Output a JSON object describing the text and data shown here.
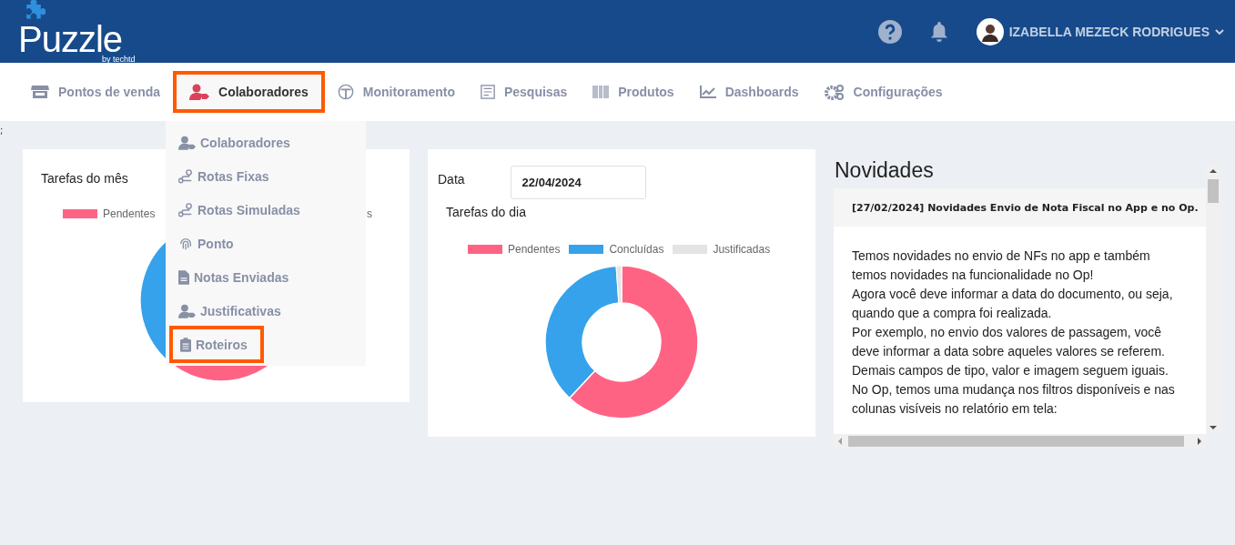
{
  "header": {
    "logo": {
      "name": "Puzzle",
      "tagline": "by techtd"
    },
    "user": {
      "name": "IZABELLA MEZECK RODRIGUES"
    }
  },
  "nav": [
    {
      "label": "Pontos de venda",
      "selected": false
    },
    {
      "label": "Colaboradores",
      "selected": true
    },
    {
      "label": "Monitoramento",
      "selected": false
    },
    {
      "label": "Pesquisas",
      "selected": false
    },
    {
      "label": "Produtos",
      "selected": false
    },
    {
      "label": "Dashboards",
      "selected": false
    },
    {
      "label": "Configurações",
      "selected": false
    }
  ],
  "dropdown": [
    {
      "label": "Colaboradores",
      "selected": false
    },
    {
      "label": "Rotas Fixas",
      "selected": false
    },
    {
      "label": "Rotas Simuladas",
      "selected": false
    },
    {
      "label": "Ponto",
      "selected": false
    },
    {
      "label": "Notas Enviadas",
      "selected": false
    },
    {
      "label": "Justificativas",
      "selected": false
    },
    {
      "label": "Roteiros",
      "selected": true
    }
  ],
  "stray_mark": ";",
  "month_card": {
    "title": "Tarefas do mês",
    "legend": [
      {
        "label": "Pendentes",
        "color": "#ff6384"
      }
    ],
    "legend_fragment": "s"
  },
  "day_card": {
    "date_label": "Data",
    "date_value": "22/04/2024",
    "title": "Tarefas do dia",
    "legend": [
      {
        "label": "Pendentes",
        "color": "#ff6384"
      },
      {
        "label": "Concluídas",
        "color": "#36a2eb"
      },
      {
        "label": "Justificadas",
        "color": "#e4e4e4"
      }
    ]
  },
  "news": {
    "title": "Novidades",
    "item_title": "[27/02/2024] Novidades Envio de Nota Fiscal no App e no Op.",
    "paragraphs": [
      "Temos novidades no envio de NFs no app e também temos novidades na funcionalidade no Op!",
      "Agora você deve informar a data do documento, ou seja, quando que a compra foi realizada.",
      "Por exemplo, no envio dos valores de passagem, você deve informar a data sobre aqueles valores se referem.",
      "Demais campos de tipo, valor e imagem seguem iguais.",
      "No Op, temos uma mudança nos filtros disponíveis e nas colunas visíveis no relatório em tela:"
    ]
  }
}
